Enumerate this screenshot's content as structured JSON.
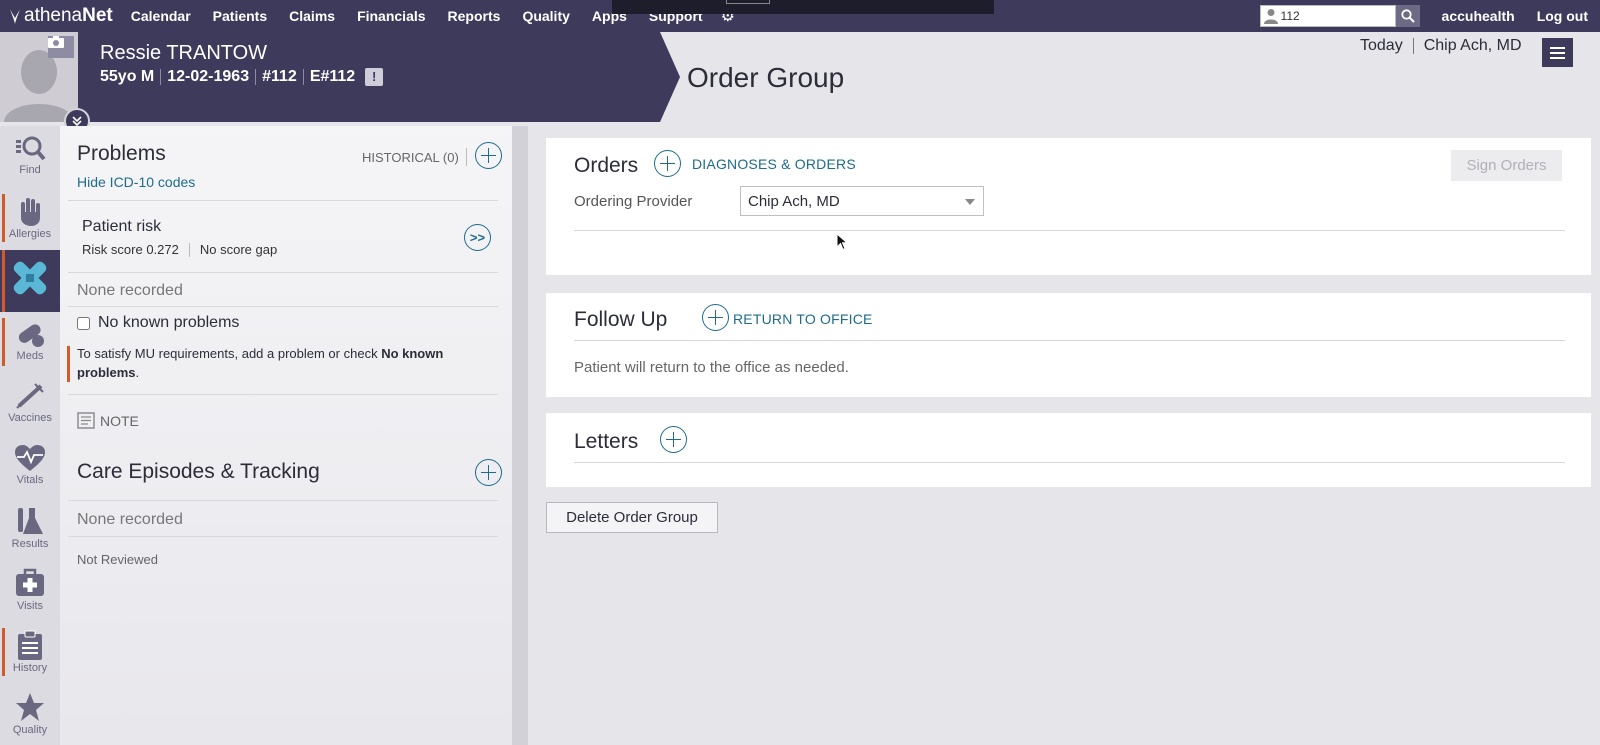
{
  "nav": {
    "brand_a": "athena",
    "brand_b": "Net",
    "items": [
      "Calendar",
      "Patients",
      "Claims",
      "Financials",
      "Reports",
      "Quality",
      "Apps",
      "Support"
    ],
    "search_value": "112",
    "practice": "accuhealth",
    "logout": "Log out"
  },
  "patient": {
    "name": "Ressie TRANTOW",
    "age_sex": "55yo M",
    "dob": "12-02-1963",
    "id": "#112",
    "enterprise_id": "E#112",
    "alert": "!"
  },
  "header": {
    "title": "Order Group",
    "date": "Today",
    "provider": "Chip Ach, MD"
  },
  "rail": [
    "Find",
    "Allergies",
    "",
    "Meds",
    "Vaccines",
    "Vitals",
    "Results",
    "Visits",
    "History",
    "Quality"
  ],
  "problems": {
    "title": "Problems",
    "hide_icd": "Hide ICD-10 codes",
    "historical": "HISTORICAL (0)",
    "risk_title": "Patient risk",
    "risk_score_label": "Risk score",
    "risk_score_value": "0.272",
    "risk_gap": "No score gap",
    "none_recorded": "None recorded",
    "no_known": "No known problems",
    "mu_text_a": "To satisfy MU requirements, add a problem or check ",
    "mu_text_b": "No known problems",
    "mu_text_c": ".",
    "note": "NOTE",
    "care_title": "Care Episodes & Tracking",
    "care_none": "None recorded",
    "not_reviewed": "Not Reviewed"
  },
  "orders": {
    "title": "Orders",
    "link": "DIAGNOSES & ORDERS",
    "sign": "Sign Orders",
    "provider_label": "Ordering Provider",
    "provider_value": "Chip Ach, MD"
  },
  "followup": {
    "title": "Follow Up",
    "link": "RETURN TO OFFICE",
    "text": "Patient will return to the office as needed."
  },
  "letters": {
    "title": "Letters"
  },
  "delete_label": "Delete Order Group",
  "colors": {
    "nav_bg": "#3d3a5c",
    "accent_link": "#1d6c8c",
    "flag": "#d55a2b"
  }
}
